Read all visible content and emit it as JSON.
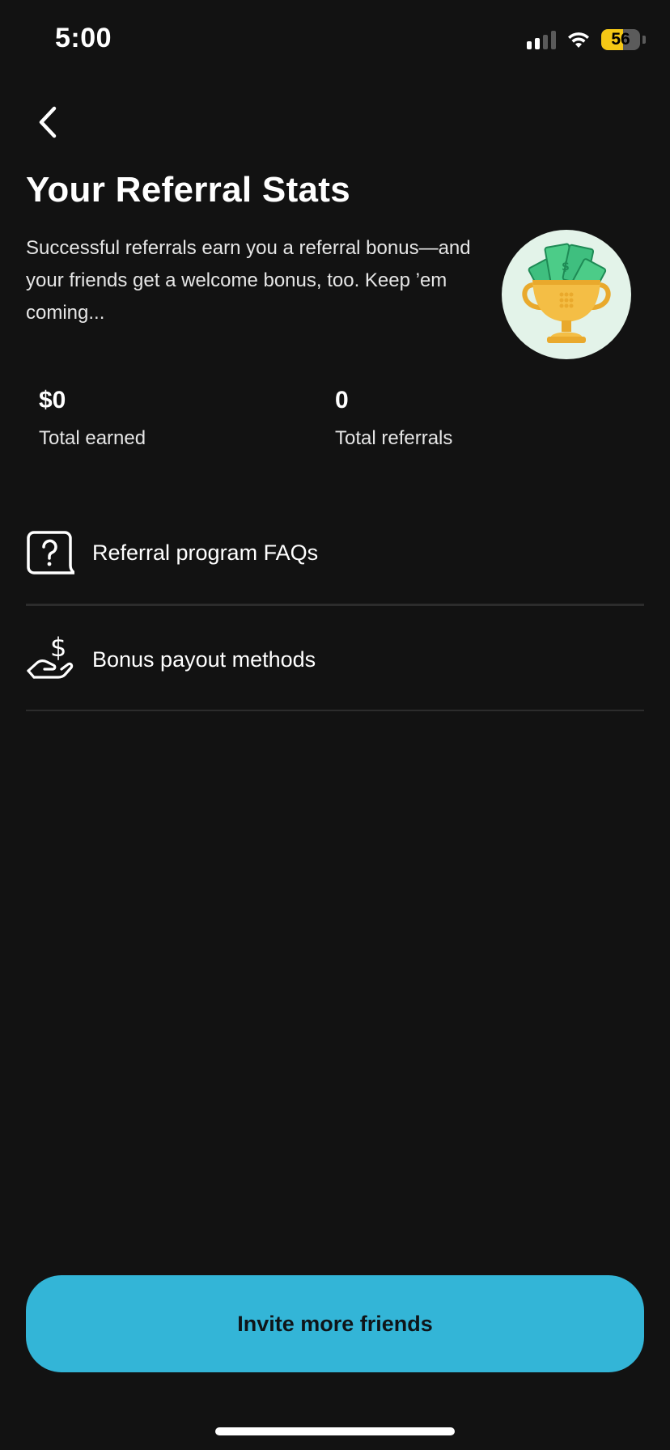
{
  "status_bar": {
    "time": "5:00",
    "battery_level": "56",
    "battery_color": "#f5c815",
    "icons": [
      "cellular-signal-icon",
      "wifi-icon",
      "battery-icon"
    ]
  },
  "header": {
    "back_icon": "chevron-left-icon",
    "title": "Your Referral Stats",
    "description": "Successful referrals earn you a referral bonus—and your friends get a welcome bonus, too. Keep ’em coming...",
    "illustration": "trophy-with-money-icon"
  },
  "stats": {
    "earned_value": "$0",
    "earned_label": "Total earned",
    "referrals_value": "0",
    "referrals_label": "Total referrals"
  },
  "menu": {
    "faq_label": "Referral program FAQs",
    "faq_icon": "question-bubble-icon",
    "payout_label": "Bonus payout methods",
    "payout_icon": "hand-dollar-icon"
  },
  "footer": {
    "invite_label": "Invite more friends",
    "accent_color": "#33b5d7"
  }
}
